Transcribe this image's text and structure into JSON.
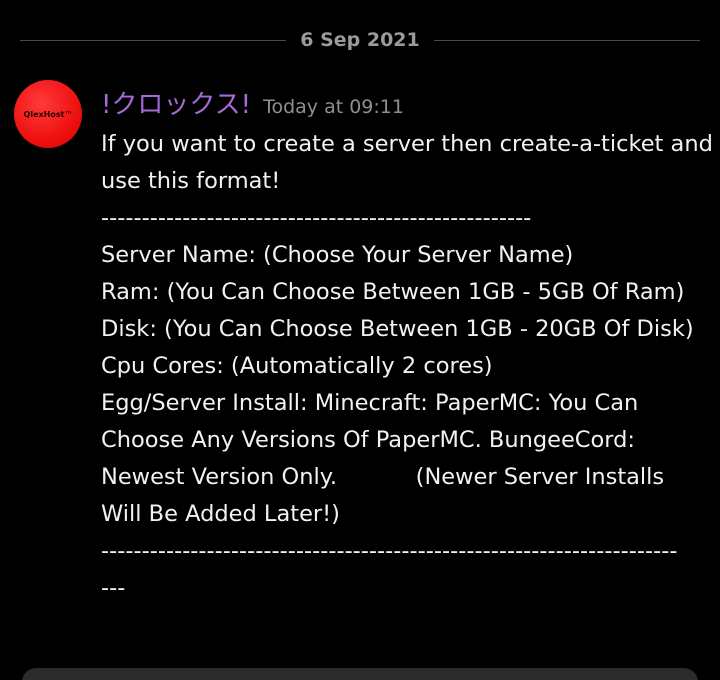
{
  "divider": {
    "date": "6 Sep 2021"
  },
  "message": {
    "avatar_text": "QlexHost™",
    "username": "!クロックス!",
    "timestamp": "Today at 09:11",
    "lines": [
      "If you want to create a server then create-a-ticket and",
      "use this format!",
      "-----------------------------------------------------",
      "Server Name: (Choose Your Server Name)",
      "Ram: (You Can Choose Between 1GB - 5GB Of Ram)",
      "Disk: (You Can Choose Between 1GB - 20GB Of Disk)",
      "Cpu Cores: (Automatically 2 cores)",
      "Egg/Server Install: Minecraft: PaperMC: You Can",
      "Choose Any Versions Of PaperMC. BungeeCord:",
      "Newest Version Only.           (Newer Server Installs",
      "Will Be Added Later!)",
      "-----------------------------------------------------------------------",
      "---"
    ]
  },
  "colors": {
    "background": "#000000",
    "username": "#a56ad8",
    "text": "#f2f2f2",
    "muted": "#8f8f8f",
    "avatar": "#f01010"
  }
}
